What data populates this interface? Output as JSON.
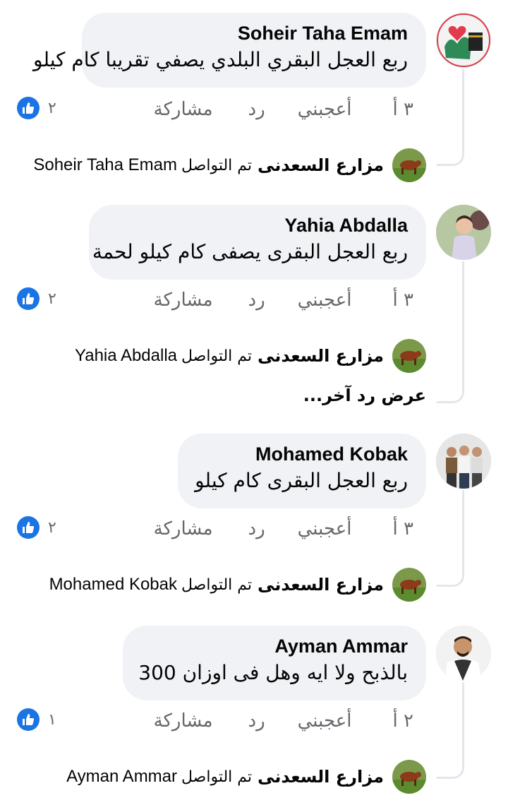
{
  "like_color": "#1b74e4",
  "comments": [
    {
      "author": "Soheir Taha Emam",
      "text": "ربع العجل البقري البلدي يصفي تقريبا كام كيلو",
      "time": "٣ أ",
      "like_label": "أعجبني",
      "reply_label": "رد",
      "share_label": "مشاركة",
      "like_count": "٢",
      "reply": {
        "author": "مزارع السعدنى",
        "text": "تم التواصل",
        "mention": "Soheir Taha Emam"
      }
    },
    {
      "author": "Yahia Abdalla",
      "text": "ربع العجل البقرى يصفى كام كيلو لحمة",
      "time": "٣ أ",
      "like_label": "أعجبني",
      "reply_label": "رد",
      "share_label": "مشاركة",
      "like_count": "٢",
      "reply": {
        "author": "مزارع السعدنى",
        "text": "تم التواصل",
        "mention": "Yahia Abdalla"
      },
      "more_replies": "عرض رد آخر..."
    },
    {
      "author": "Mohamed Kobak",
      "text": "ربع العجل البقرى  كام  كيلو",
      "time": "٣ أ",
      "like_label": "أعجبني",
      "reply_label": "رد",
      "share_label": "مشاركة",
      "like_count": "٢",
      "reply": {
        "author": "مزارع السعدنى",
        "text": "تم التواصل",
        "mention": "Mohamed Kobak"
      }
    },
    {
      "author": "Ayman Ammar",
      "text": "بالذبح ولا ايه وهل فى اوزان 300",
      "time": "٢ أ",
      "like_label": "أعجبني",
      "reply_label": "رد",
      "share_label": "مشاركة",
      "like_count": "١",
      "reply": {
        "author": "مزارع السعدنى",
        "text": "تم التواصل",
        "mention": "Ayman Ammar"
      }
    }
  ]
}
